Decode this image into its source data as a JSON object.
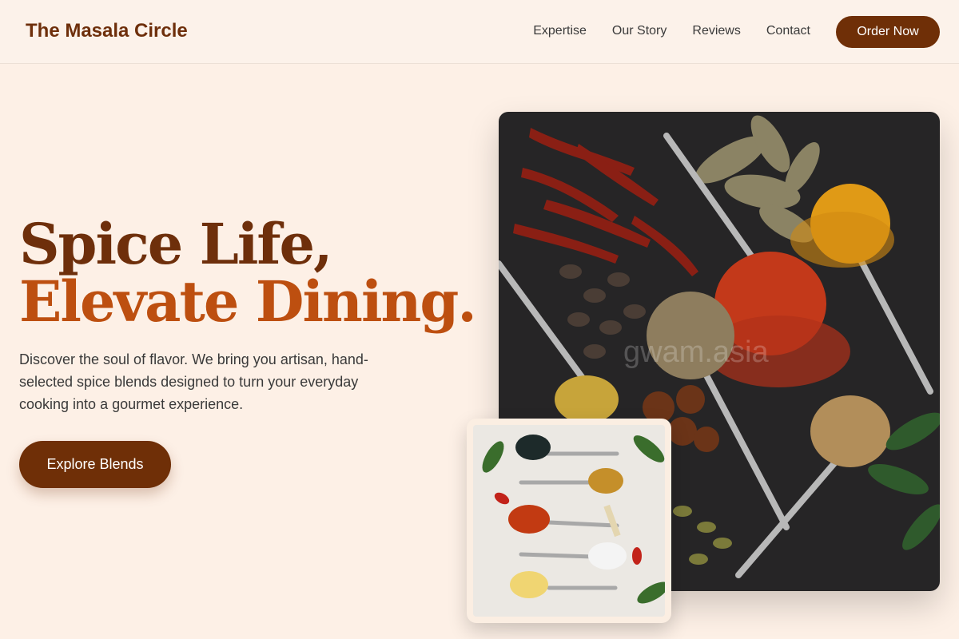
{
  "brand": "The Masala Circle",
  "nav": {
    "links": [
      "Expertise",
      "Our Story",
      "Reviews",
      "Contact"
    ],
    "cta": "Order Now"
  },
  "hero": {
    "headline_line1": "Spice Life,",
    "headline_line2": "Elevate Dining.",
    "description": "Discover the soul of flavor. We bring you artisan, hand-selected spice blends designed to turn your everyday cooking into a gourmet experience.",
    "cta": "Explore Blends"
  },
  "images": {
    "main_image": "spices-on-dark-background-photo",
    "small_image": "spices-on-spoons-white-background-photo",
    "watermark": "gwam.asia"
  },
  "colors": {
    "background": "#fdf0e6",
    "brand_brown": "#6f2f07",
    "accent_orange": "#bd4f10"
  }
}
